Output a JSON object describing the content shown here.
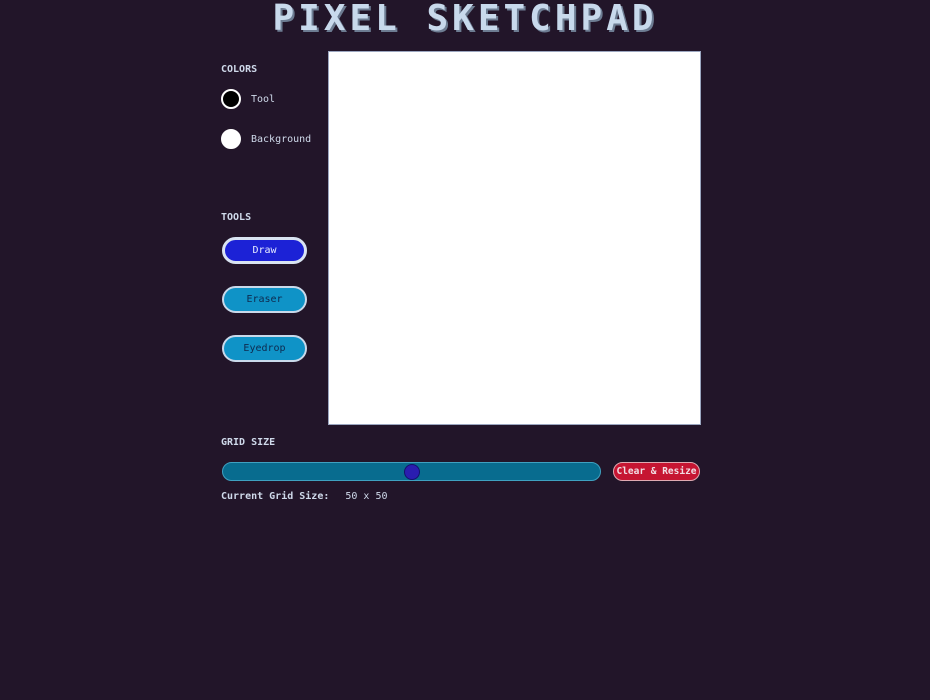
{
  "app": {
    "title": "PIXEL SKETCHPAD"
  },
  "colors": {
    "heading": "COLORS",
    "tool": {
      "label": "Tool",
      "value": "#000000"
    },
    "background": {
      "label": "Background",
      "value": "#ffffff"
    }
  },
  "tools": {
    "heading": "TOOLS",
    "items": [
      {
        "label": "Draw",
        "active": true
      },
      {
        "label": "Eraser",
        "active": false
      },
      {
        "label": "Eyedrop",
        "active": false
      }
    ]
  },
  "grid": {
    "heading": "GRID SIZE",
    "slider_fraction": 0.5,
    "clear_label": "Clear & Resize",
    "current_label": "Current Grid Size:",
    "current_value": "50 x 50"
  },
  "theme": {
    "page_bg": "#221529",
    "active_tool": "#1c22d6",
    "tool_button": "#0f93c7",
    "slider_track": "#086c8f",
    "slider_thumb": "#2a1db0",
    "danger": "#c61532"
  }
}
